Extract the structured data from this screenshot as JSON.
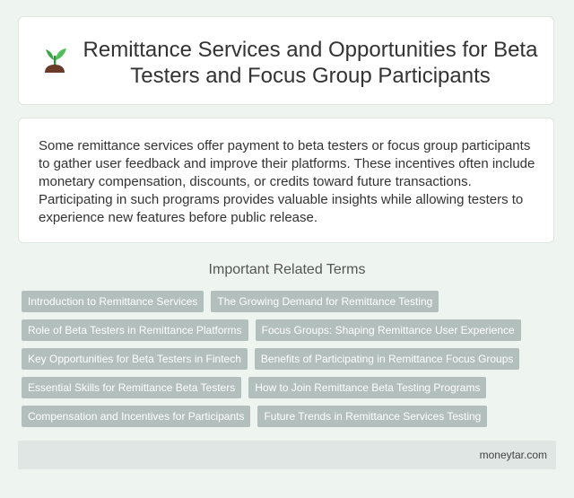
{
  "header": {
    "title": "Remittance Services and Opportunities for Beta Testers and Focus Group Participants",
    "icon": "sprout-icon"
  },
  "summary": {
    "text": "Some remittance services offer payment to beta testers or focus group participants to gather user feedback and improve their platforms. These incentives often include monetary compensation, discounts, or credits toward future transactions. Participating in such programs provides valuable insights while allowing testers to experience new features before public release."
  },
  "related": {
    "heading": "Important Related Terms",
    "rows": [
      [
        "Introduction to Remittance Services",
        "The Growing Demand for Remittance Testing"
      ],
      [
        "Role of Beta Testers in Remittance Platforms",
        "Focus Groups: Shaping Remittance User Experience"
      ],
      [
        "Key Opportunities for Beta Testers in Fintech",
        "Benefits of Participating in Remittance Focus Groups"
      ],
      [
        "Essential Skills for Remittance Beta Testers",
        "How to Join Remittance Beta Testing Programs"
      ],
      [
        "Compensation and Incentives for Participants",
        "Future Trends in Remittance Services Testing"
      ]
    ]
  },
  "footer": {
    "site": "moneytar.com"
  },
  "colors": {
    "page_background": "#eef4f0",
    "tag_background": "#b3bfbd",
    "sprout_leaf": "#3aa64a",
    "sprout_soil": "#6b3b2a"
  }
}
